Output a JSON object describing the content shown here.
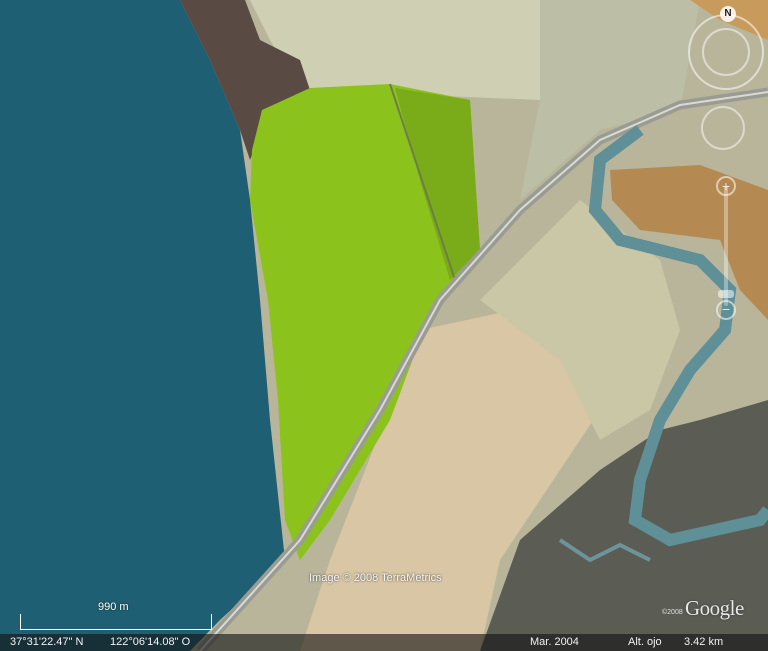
{
  "map": {
    "copyright": "Image © 2008 TerraMetrics",
    "logo": "Google",
    "logo_small": "©2008",
    "scale_label": "990 m"
  },
  "navigation": {
    "north_label": "N"
  },
  "status_bar": {
    "latitude": "37°31'22.47\" N",
    "longitude": "122°06'14.08\" O",
    "image_date": "Mar. 2004",
    "eye_alt_label": "Alt. ojo",
    "eye_alt_value": "3.42 km"
  },
  "colors": {
    "bay_water": "#1f5f73",
    "salt_pond_green": "#8cc21c",
    "marsh": "#6b6b62",
    "channel": "#5f8f97"
  }
}
